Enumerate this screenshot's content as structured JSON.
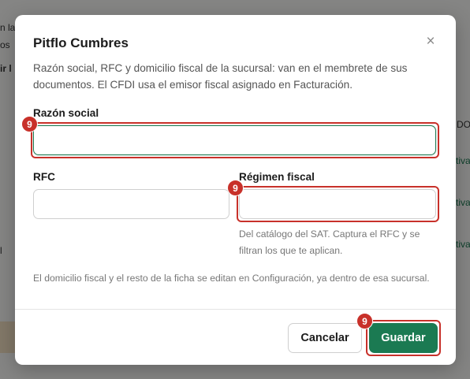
{
  "background": {
    "fragments": [
      "n la",
      "os",
      "ir l",
      "DO",
      "tiva",
      "tiva",
      "tiva",
      "l",
      "cur"
    ]
  },
  "modal": {
    "title": "Pitflo Cumbres",
    "description": "Razón social, RFC y domicilio fiscal de la sucursal: van en el membrete de sus documentos. El CFDI usa el emisor fiscal asignado en Facturación.",
    "fields": {
      "razon_social": {
        "label": "Razón social",
        "value": ""
      },
      "rfc": {
        "label": "RFC",
        "value": ""
      },
      "regimen": {
        "label": "Régimen fiscal",
        "value": "",
        "help": "Del catálogo del SAT. Captura el RFC y se filtran los que te aplican."
      }
    },
    "note": "El domicilio fiscal y el resto de la ficha se editan en Configuración, ya dentro de esa sucursal.",
    "buttons": {
      "cancel": "Cancelar",
      "save": "Guardar"
    },
    "close_icon": "×"
  },
  "annotations": {
    "badge": "9"
  },
  "colors": {
    "accent": "#1b7a52",
    "highlight": "#c8312a"
  }
}
